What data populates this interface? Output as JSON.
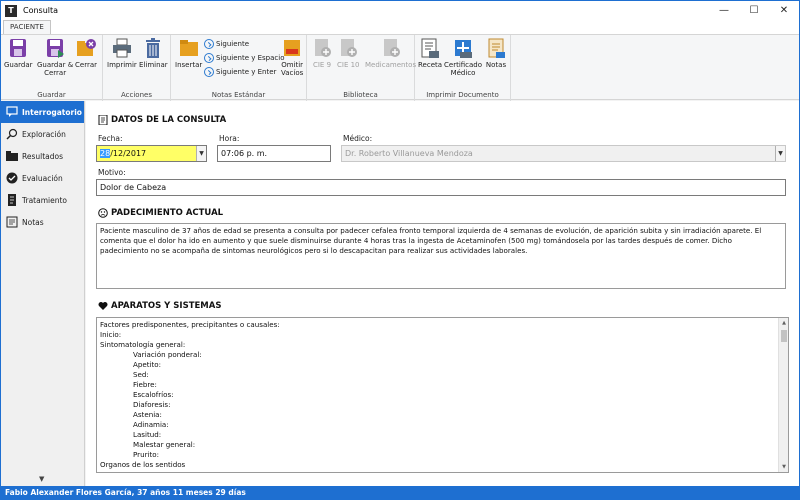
{
  "window": {
    "title": "Consulta",
    "app_icon_letter": "T",
    "controls": {
      "minimize": "—",
      "maximize": "☐",
      "close": "✕"
    }
  },
  "ribbon": {
    "tab": "PACIENTE",
    "groups": {
      "guardar": {
        "label": "Guardar",
        "buttons": {
          "guardar": "Guardar",
          "guardar_cerrar_1": "Guardar &",
          "guardar_cerrar_2": "Cerrar",
          "cerrar": "Cerrar"
        }
      },
      "acciones": {
        "label": "Acciones",
        "buttons": {
          "imprimir": "Imprimir",
          "eliminar": "Eliminar"
        }
      },
      "notas": {
        "label": "Notas Estándar",
        "buttons": {
          "insertar": "Insertar",
          "siguiente": "Siguiente",
          "siguiente_espacio": "Siguiente y Espacio",
          "siguiente_enter": "Siguiente y Enter",
          "omitir_1": "Omitir",
          "omitir_2": "Vacíos"
        }
      },
      "biblioteca": {
        "label": "Biblioteca",
        "buttons": {
          "cie9": "CIE 9",
          "cie10": "CIE 10",
          "medicamentos": "Medicamentos"
        }
      },
      "imprimir_doc": {
        "label": "Imprimir Documento",
        "buttons": {
          "receta": "Receta",
          "certificado_1": "Certificado",
          "certificado_2": "Médico",
          "notas": "Notas"
        }
      }
    }
  },
  "sidebar": {
    "items": [
      {
        "label": "Interrogatorio",
        "icon": "chat-icon",
        "active": true
      },
      {
        "label": "Exploración",
        "icon": "magnifier-icon",
        "active": false
      },
      {
        "label": "Resultados",
        "icon": "folder-icon",
        "active": false
      },
      {
        "label": "Evaluación",
        "icon": "check-circle-icon",
        "active": false
      },
      {
        "label": "Tratamiento",
        "icon": "document-icon",
        "active": false
      },
      {
        "label": "Notas",
        "icon": "notes-icon",
        "active": false
      }
    ],
    "scroll_arrow": "▼"
  },
  "datos": {
    "section_title": "DATOS DE LA CONSULTA",
    "fecha_label": "Fecha:",
    "fecha_day": "28",
    "fecha_rest": "/12/2017",
    "hora_label": "Hora:",
    "hora_value": "07:06  p. m.",
    "medico_label": "Médico:",
    "medico_value": "Dr. Roberto Villanueva Mendoza",
    "motivo_label": "Motivo:",
    "motivo_value": "Dolor de Cabeza"
  },
  "padecimiento": {
    "section_title": "PADECIMIENTO ACTUAL",
    "text": "Paciente masculino de 37 años de edad se presenta a consulta por padecer cefalea fronto temporal izquierda de 4 semanas de evolución, de aparición subita y sin irradiación aparete. El comenta que el dolor ha ido en aumento y que suele disminuirse durante 4 horas tras la ingesta de Acetaminofen (500 mg) tomándosela por las tardes después de comer. Dicho padecimiento no se acompaña de sintomas neurológicos pero si lo descapacitan para realizar sus actividades laborales."
  },
  "aparatos": {
    "section_title": "APARATOS Y SISTEMAS",
    "lines": [
      {
        "text": "Factores predisponentes, precipitantes o causales:",
        "indent": false
      },
      {
        "text": "Inicio:",
        "indent": false
      },
      {
        "text": "Sintomatología general:",
        "indent": false
      },
      {
        "text": "Variación ponderal:",
        "indent": true
      },
      {
        "text": "Apetito:",
        "indent": true
      },
      {
        "text": "Sed:",
        "indent": true
      },
      {
        "text": "Fiebre:",
        "indent": true
      },
      {
        "text": "Escalofríos:",
        "indent": true
      },
      {
        "text": "Diaforesis:",
        "indent": true
      },
      {
        "text": "Astenia:",
        "indent": true
      },
      {
        "text": "Adinamia:",
        "indent": true
      },
      {
        "text": "Lasitud:",
        "indent": true
      },
      {
        "text": "Malestar general:",
        "indent": true
      },
      {
        "text": "Prurito:",
        "indent": true
      },
      {
        "text": "Organos de los sentidos",
        "indent": false
      }
    ]
  },
  "status": {
    "text": "Fabio Alexander Flores García, 37 años 11 meses 29 días"
  },
  "colors": {
    "accent": "#1e6fd1",
    "date_highlight": "#ffff66"
  }
}
